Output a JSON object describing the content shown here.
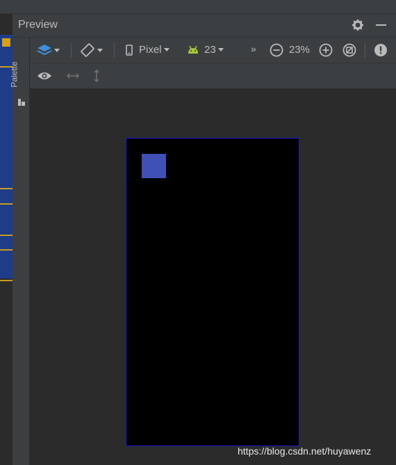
{
  "panel": {
    "title": "Preview",
    "palette_tab_label": "Palette"
  },
  "toolbar": {
    "design_surface_icon": "layers-icon",
    "orientation_icon": "rotate-device-icon",
    "device_label": "Pixel",
    "api_level_label": "23",
    "overflow_label": "»",
    "zoom_label": "23%",
    "zoom_out_icon": "zoom-out-icon",
    "zoom_in_icon": "zoom-in-icon",
    "zoom_fit_icon": "zoom-fit-icon",
    "warnings_icon": "warning-icon"
  },
  "toolbar2": {
    "eye_icon": "eye-icon",
    "horizontal_resize_icon": "horizontal-resize-icon",
    "vertical_resize_icon": "vertical-resize-icon"
  },
  "watermark": "https://blog.csdn.net/huyawenz",
  "colors": {
    "panel_bg": "#3c3f41",
    "canvas_bg": "#2b2b2b",
    "device_screen": "#000000",
    "device_border": "#1a1ad0",
    "view_color": "#3f51b5",
    "android_green": "#a4c639",
    "layers_blue": "#3e8ede"
  }
}
